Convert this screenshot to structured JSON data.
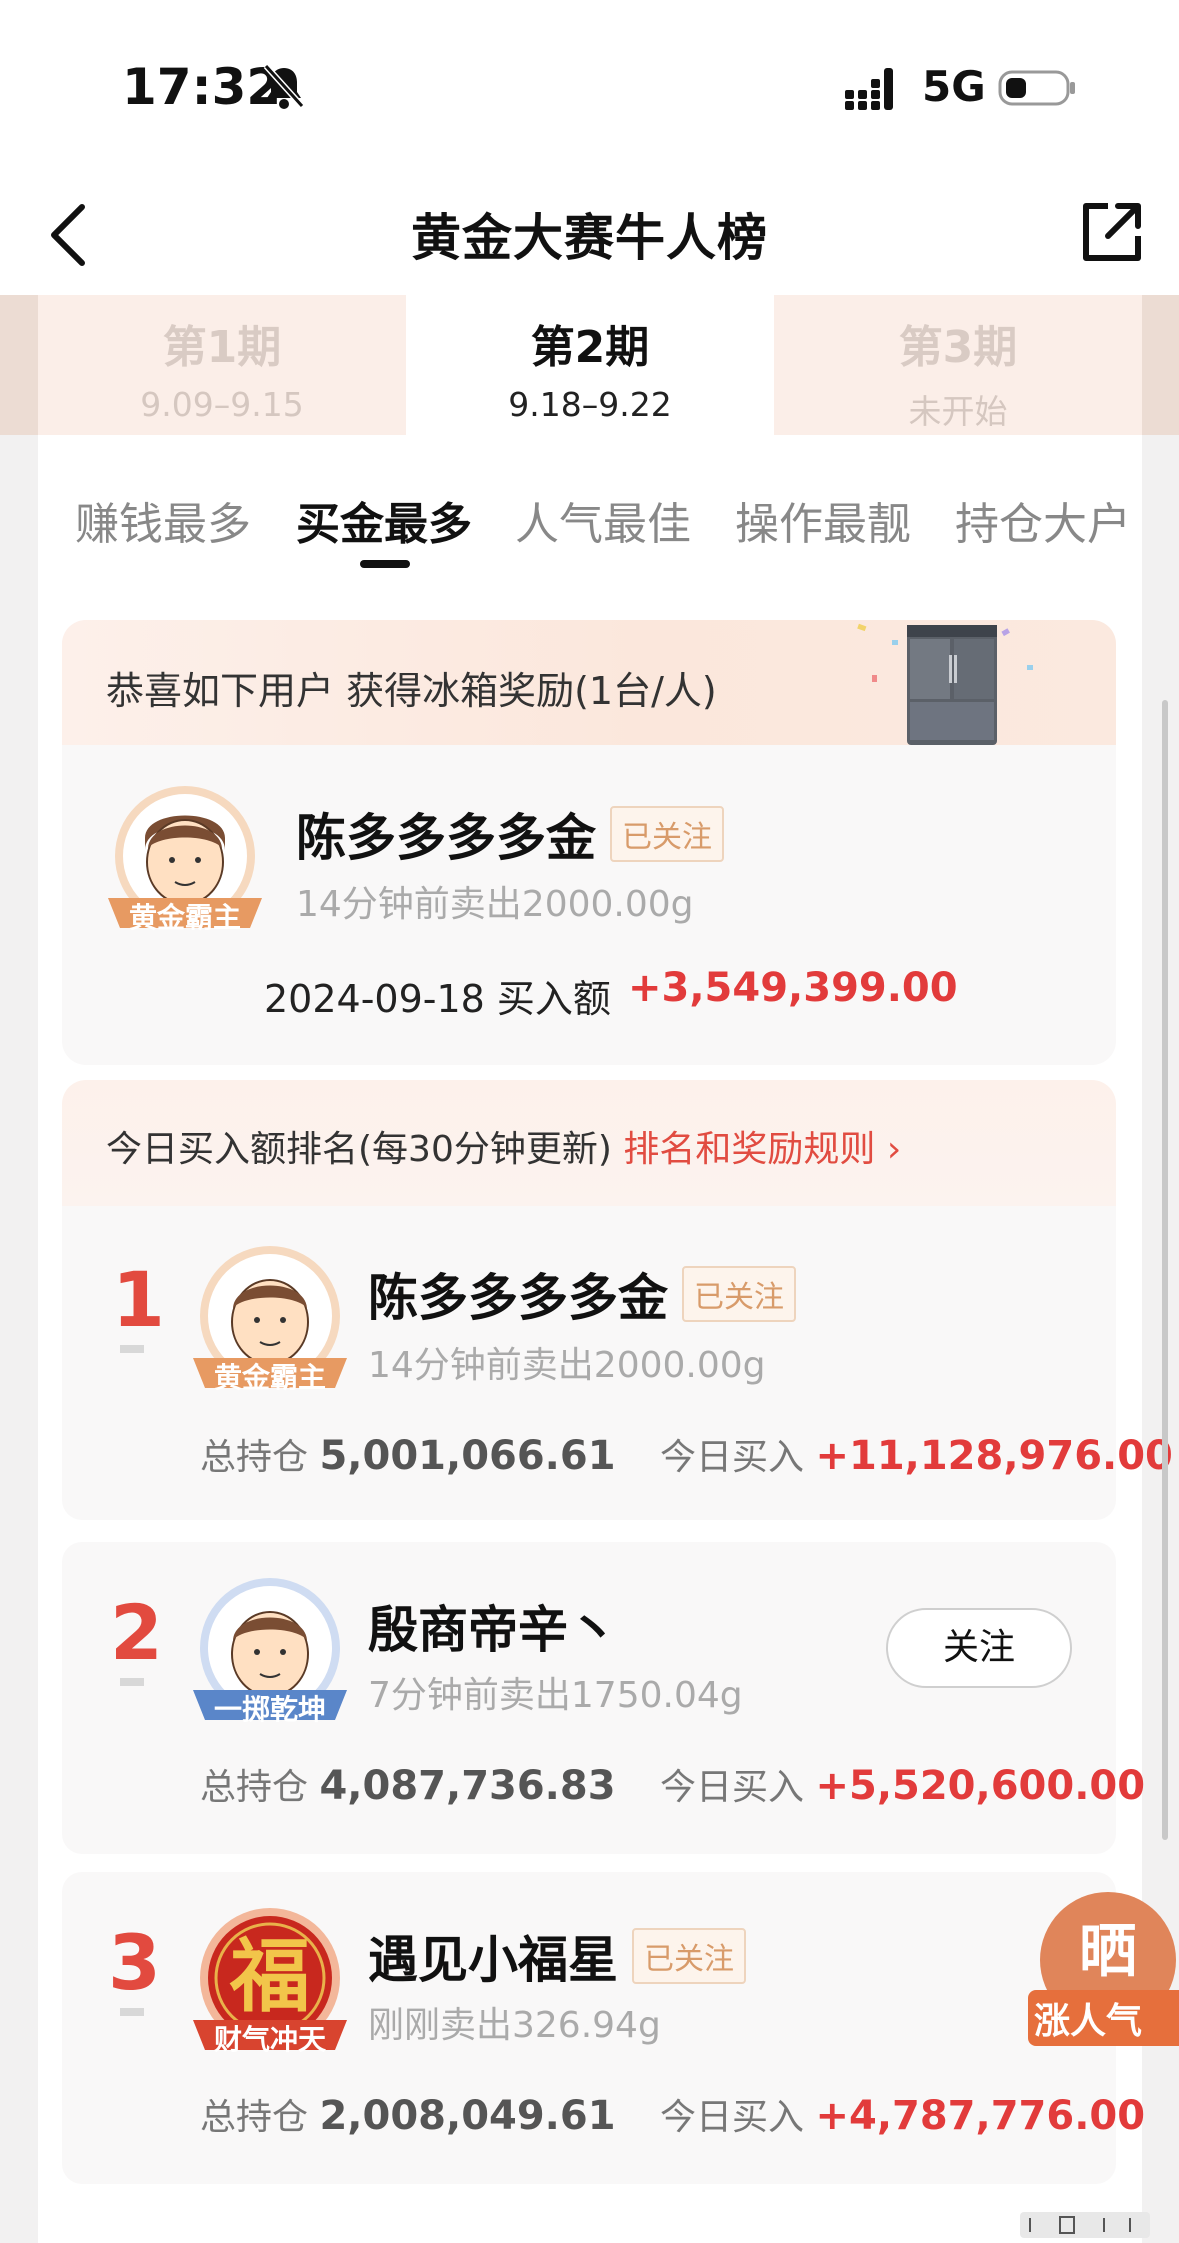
{
  "status_bar": {
    "time": "17:32",
    "network": "5G"
  },
  "nav": {
    "title": "黄金大赛牛人榜"
  },
  "periods": [
    {
      "label": "第1期",
      "dates": "9.09–9.15"
    },
    {
      "label": "第2期",
      "dates": "9.18–9.22"
    },
    {
      "label": "第3期",
      "dates": "未开始"
    }
  ],
  "category_tabs": [
    "赚钱最多",
    "买金最多",
    "人气最佳",
    "操作最靓",
    "持仓大户"
  ],
  "award": {
    "text": "恭喜如下用户  获得冰箱奖励(1台/人)",
    "winner": {
      "name": "陈多多多多金",
      "follow": "已关注",
      "badge": "黄金霸主",
      "activity": "14分钟前卖出2000.00g",
      "date_label": "2024-09-18 买入额",
      "amount": "+3,549,399.00"
    }
  },
  "ranking": {
    "header": "今日买入额排名(每30分钟更新)",
    "rules_link": "排名和奖励规则",
    "hold_label": "总持仓",
    "buy_label": "今日买入",
    "items": [
      {
        "rank": "1",
        "name": "陈多多多多金",
        "follow": "已关注",
        "badge": "黄金霸主",
        "activity": "14分钟前卖出2000.00g",
        "holding": "5,001,066.61",
        "today_buy": "+11,128,976.00"
      },
      {
        "rank": "2",
        "name": "殷商帝辛丶",
        "follow": "关注",
        "badge": "一掷乾坤",
        "activity": "7分钟前卖出1750.04g",
        "holding": "4,087,736.83",
        "today_buy": "+5,520,600.00"
      },
      {
        "rank": "3",
        "name": "遇见小福星",
        "follow": "已关注",
        "badge": "财气冲天",
        "activity": "刚刚卖出326.94g",
        "holding": "2,008,049.61",
        "today_buy": "+4,787,776.00"
      }
    ]
  },
  "float_button": {
    "char": "晒",
    "label": "涨人气"
  },
  "colors": {
    "accent_red": "#e23b3b",
    "gold": "#d89b6a",
    "badge_blue": "#5a86c9",
    "badge_red": "#c83a2a"
  }
}
